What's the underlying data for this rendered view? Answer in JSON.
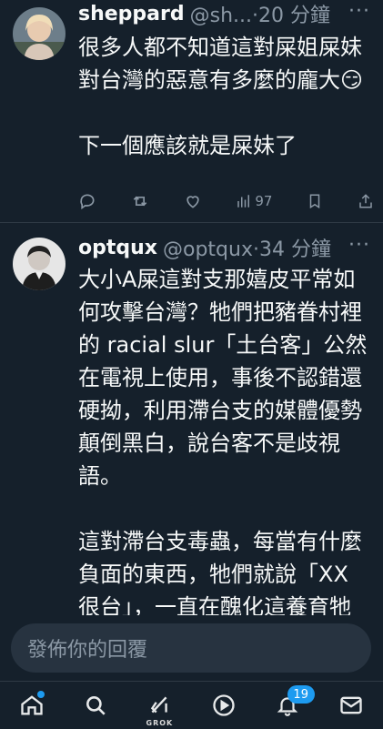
{
  "tweets": [
    {
      "name": "sheppard",
      "meta": "@sh...·20 分鐘",
      "more": "···",
      "paragraphs": [
        "很多人都不知道這對屎姐屎妹對台灣的惡意有多麼的龐大😏",
        "下一個應該就是屎妹了"
      ],
      "actions": {
        "reply": "",
        "retweet": "",
        "like": "",
        "views": "97"
      }
    },
    {
      "name": "optqux",
      "meta": "@optqux·34 分鐘",
      "more": "···",
      "paragraphs": [
        "大小A屎這對支那嬉皮平常如何攻擊台灣？牠們把豬眷村裡的 racial slur「土台客」公然在電視上使用，事後不認錯還硬拗，利用滯台支的媒體優勢顛倒黑白，說台客不是歧視語。",
        "這對滯台支毒蟲，每當有什麼負面的東西，牠們就說「XX很台」，一直在醜化這養育牠們的土地，滯台支團"
      ]
    }
  ],
  "reply": {
    "placeholder": "發佈你的回覆"
  },
  "nav": {
    "items": [
      "home-icon",
      "search-icon",
      "grok-icon",
      "play-icon",
      "bell-icon",
      "mail-icon"
    ],
    "grok_label": "GROK",
    "notifications_count": "19"
  },
  "colors": {
    "background": "#15202b",
    "accent": "#1d9bf0",
    "muted": "#8b98a5"
  }
}
